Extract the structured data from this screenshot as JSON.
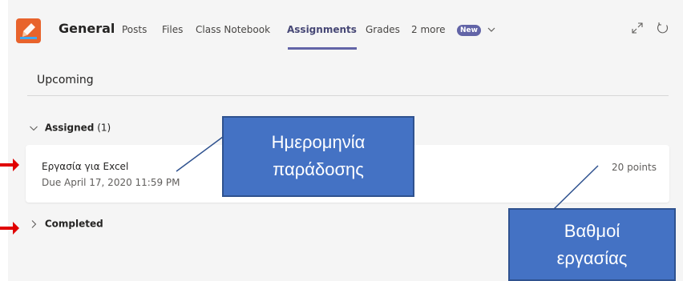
{
  "header": {
    "team_name": "General",
    "tabs": [
      {
        "label": "Posts"
      },
      {
        "label": "Files"
      },
      {
        "label": "Class Notebook"
      },
      {
        "label": "Assignments",
        "active": true
      },
      {
        "label": "Grades"
      },
      {
        "label": "2 more"
      }
    ],
    "new_badge": "New",
    "accent_color": "#6264a7",
    "app_icon_color": "#e8632c"
  },
  "section": {
    "title": "Upcoming"
  },
  "groups": {
    "assigned": {
      "label": "Assigned",
      "count": "(1)",
      "expanded": true
    },
    "completed": {
      "label": "Completed",
      "expanded": false
    }
  },
  "assignment": {
    "title": "Εργασία για Excel",
    "due": "Due April 17, 2020 11:59 PM",
    "points": "20 points"
  },
  "annotations": {
    "due_date": {
      "line1": "Ημερομηνία",
      "line2": "παράδοσης"
    },
    "grade": {
      "line1": "Βαθμοί",
      "line2": "εργασίας"
    },
    "callout_color": "#4472c4",
    "arrow_color": "#e00000"
  }
}
